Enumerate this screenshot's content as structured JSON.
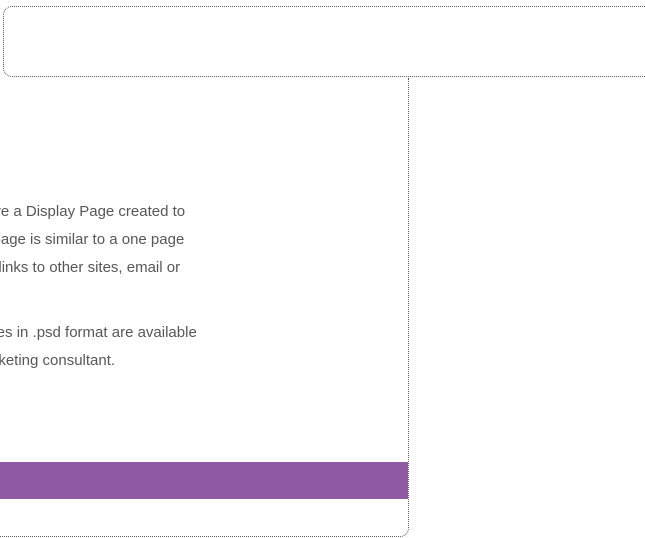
{
  "colors": {
    "background": "#ffffff",
    "border": "#5a5a5a",
    "text": "#575757",
    "accent": "#8f5aa1"
  },
  "content": {
    "paragraph_1_lines": [
      "to have a Display Page created to",
      "This page is similar to a one page",
      "ature links to other sites, email or"
    ],
    "paragraph_2_lines": [
      "mplates in .psd format are available",
      "ir marketing consultant."
    ]
  }
}
